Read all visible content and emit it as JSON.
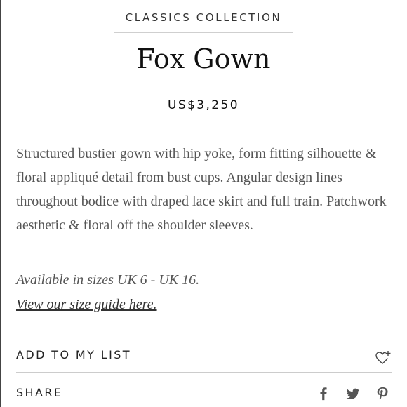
{
  "product": {
    "collection": "CLASSICS COLLECTION",
    "name": "Fox Gown",
    "price": "US$3,250",
    "description": "Structured bustier gown with hip yoke, form fitting silhouette & floral appliqué detail from bust cups. Angular design lines throughout bodice with draped lace skirt and full train. Patchwork aesthetic & floral off the shoulder sleeves.",
    "sizes_note": "Available in sizes UK 6 - UK 16.",
    "size_guide_link": "View our size guide here."
  },
  "actions": {
    "add_to_list_label": "ADD TO MY LIST",
    "add_to_list_icon": "heart-plus-icon",
    "share_label": "SHARE",
    "share_icons": [
      "facebook-icon",
      "twitter-icon",
      "pinterest-icon"
    ]
  },
  "colors": {
    "text_dark": "#1a1a1a",
    "text_body": "#555555",
    "divider": "#cccccc"
  }
}
